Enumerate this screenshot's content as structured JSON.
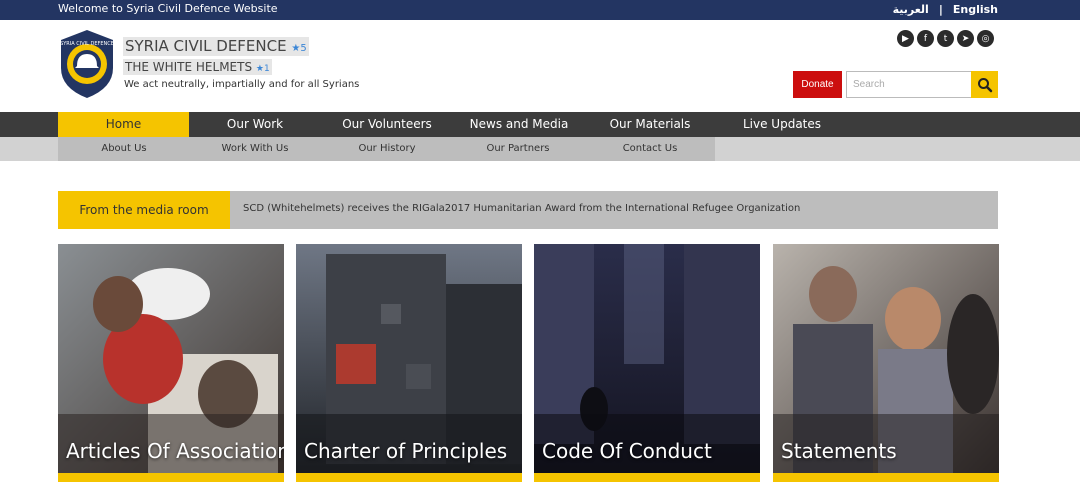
{
  "topbar": {
    "welcome": "Welcome to Syria Civil Defence Website",
    "lang_ar": "العربية",
    "lang_sep": "|",
    "lang_en": "English"
  },
  "header": {
    "title": "SYRIA CIVIL DEFENCE",
    "title_star": "★5",
    "subtitle": "THE WHITE HELMETS",
    "subtitle_star": "★1",
    "tagline": "We act neutrally, impartially and for all Syrians"
  },
  "socials": [
    "youtube-icon",
    "facebook-icon",
    "twitter-icon",
    "telegram-icon",
    "instagram-icon"
  ],
  "donate_label": "Donate",
  "search": {
    "placeholder": "Search",
    "value": ""
  },
  "mainnav": [
    {
      "label": "Home",
      "active": true
    },
    {
      "label": "Our Work"
    },
    {
      "label": "Our Volunteers"
    },
    {
      "label": "News and Media"
    },
    {
      "label": "Our Materials"
    },
    {
      "label": "Live Updates"
    }
  ],
  "subnav": [
    {
      "label": "About Us"
    },
    {
      "label": "Work With Us"
    },
    {
      "label": "Our History"
    },
    {
      "label": "Our Partners"
    },
    {
      "label": "Contact Us"
    }
  ],
  "ticker": {
    "label": "From the media room",
    "text": "SCD (Whitehelmets) receives the RIGala2017 Humanitarian Award from the International Refugee Organization"
  },
  "cards": [
    {
      "caption": "Articles Of Association"
    },
    {
      "caption": "Charter of Principles"
    },
    {
      "caption": "Code Of Conduct"
    },
    {
      "caption": "Statements"
    }
  ],
  "colors": {
    "topbar": "#233562",
    "accent": "#f5c400",
    "donate": "#cc0e0e",
    "nav": "#3c3c3c"
  }
}
